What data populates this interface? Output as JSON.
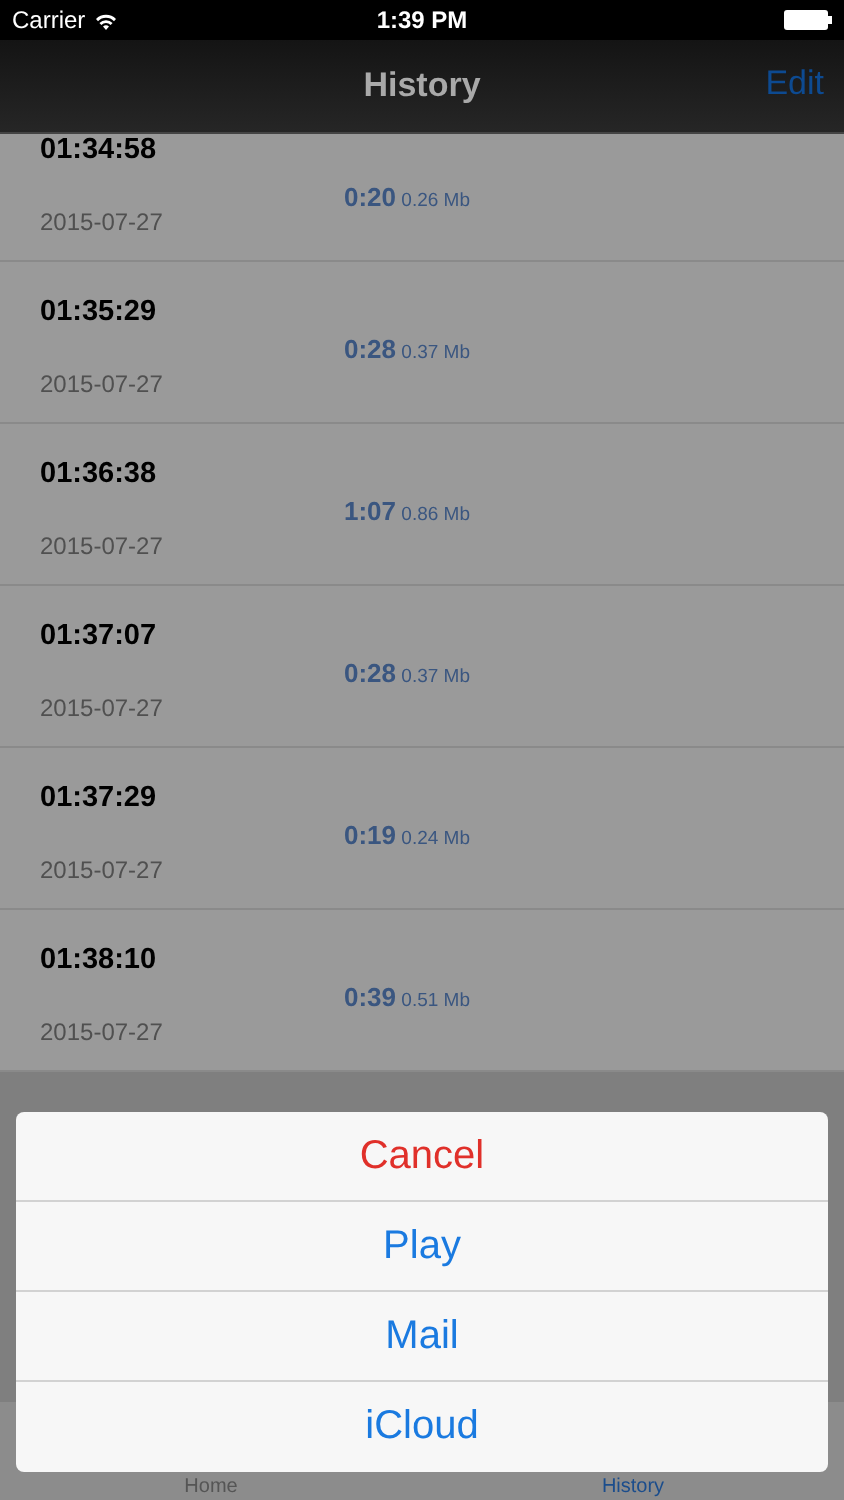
{
  "status_bar": {
    "carrier": "Carrier",
    "time": "1:39 PM"
  },
  "nav": {
    "title": "History",
    "edit": "Edit"
  },
  "rows": [
    {
      "time": "01:34:58",
      "date": "2015-07-27",
      "duration": "0:20",
      "size": "0.26 Mb"
    },
    {
      "time": "01:35:29",
      "date": "2015-07-27",
      "duration": "0:28",
      "size": "0.37 Mb"
    },
    {
      "time": "01:36:38",
      "date": "2015-07-27",
      "duration": "1:07",
      "size": "0.86 Mb"
    },
    {
      "time": "01:37:07",
      "date": "2015-07-27",
      "duration": "0:28",
      "size": "0.37 Mb"
    },
    {
      "time": "01:37:29",
      "date": "2015-07-27",
      "duration": "0:19",
      "size": "0.24 Mb"
    },
    {
      "time": "01:38:10",
      "date": "2015-07-27",
      "duration": "0:39",
      "size": "0.51 Mb"
    }
  ],
  "action_sheet": [
    {
      "label": "Cancel",
      "kind": "destructive"
    },
    {
      "label": "Play",
      "kind": "default"
    },
    {
      "label": "Mail",
      "kind": "default"
    },
    {
      "label": "iCloud",
      "kind": "default"
    }
  ],
  "tabs": [
    {
      "label": "Home",
      "selected": false
    },
    {
      "label": "History",
      "selected": true
    }
  ]
}
